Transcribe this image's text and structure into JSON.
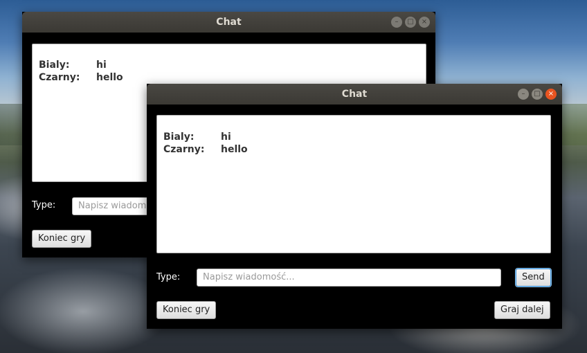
{
  "windows": {
    "back": {
      "title": "Chat",
      "messages": [
        {
          "sender": "Bialy:",
          "text": "hi"
        },
        {
          "sender": "Czarny:",
          "text": "hello"
        }
      ],
      "type_label": "Type:",
      "input_placeholder": "Napisz wiadomość...",
      "end_game_button": "Koniec gry"
    },
    "front": {
      "title": "Chat",
      "messages": [
        {
          "sender": "Bialy:",
          "text": "hi"
        },
        {
          "sender": "Czarny:",
          "text": "hello"
        }
      ],
      "type_label": "Type:",
      "input_placeholder": "Napisz wiadomość...",
      "send_button": "Send",
      "end_game_button": "Koniec gry",
      "continue_button": "Graj dalej"
    }
  },
  "icons": {
    "minimize": "minimize-icon",
    "maximize": "maximize-icon",
    "close": "close-icon"
  },
  "colors": {
    "close_active": "#e95420",
    "titlebar": "#3b3934",
    "window_body": "#000000"
  }
}
